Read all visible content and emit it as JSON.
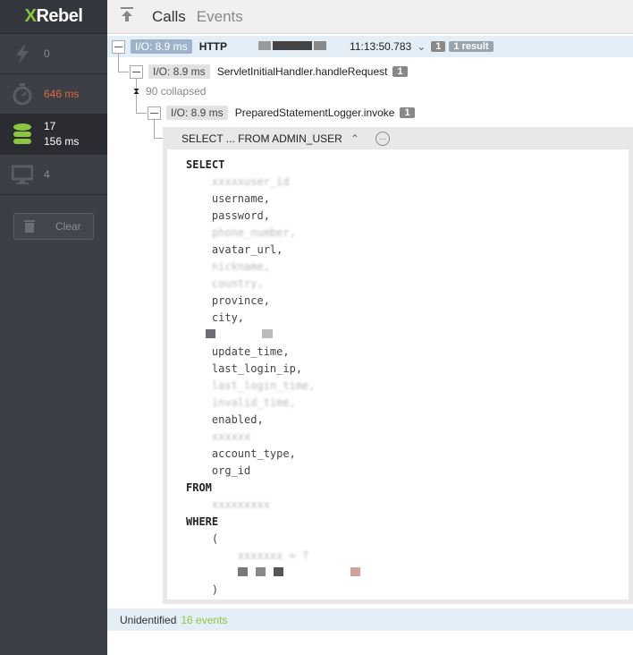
{
  "sidebar": {
    "logo": "XRebel",
    "items": [
      {
        "icon": "lightning-icon",
        "value": "0"
      },
      {
        "icon": "stopwatch-icon",
        "value": "646 ms",
        "color": "#e0663c"
      },
      {
        "icon": "database-icon",
        "value": "17",
        "value2": "156 ms",
        "selected": true
      },
      {
        "icon": "monitor-icon",
        "value": "4"
      }
    ],
    "clear_label": "Clear"
  },
  "header": {
    "tabs": [
      "Calls",
      "Events"
    ],
    "active": "Calls"
  },
  "tree": {
    "root": {
      "io": "I/O: 8.9 ms",
      "type": "HTTP",
      "time": "11:13:50.783",
      "count": "1",
      "result": "1 result"
    },
    "handler": {
      "io": "I/O: 8.9 ms",
      "name": "ServletInitialHandler.handleRequest",
      "count": "1"
    },
    "collapsed": "90 collapsed",
    "logger": {
      "io": "I/O: 8.9 ms",
      "name": "PreparedStatementLogger.invoke",
      "count": "1"
    },
    "sql_title": "SELECT ... FROM ADMIN_USER"
  },
  "sql": {
    "select": "SELECT",
    "columns": [
      "username,",
      "password,",
      "phone_number,",
      "avatar_url,",
      "province,",
      "city,",
      "update_time,",
      "last_login_ip,",
      "last_login_time,",
      "invalid_time,",
      "enabled,",
      "account_type,",
      "org_id"
    ],
    "from": "FROM",
    "where": "WHERE",
    "open": "(",
    "close": ")"
  },
  "footer": {
    "label": "Unidentified",
    "events": "16 events"
  }
}
